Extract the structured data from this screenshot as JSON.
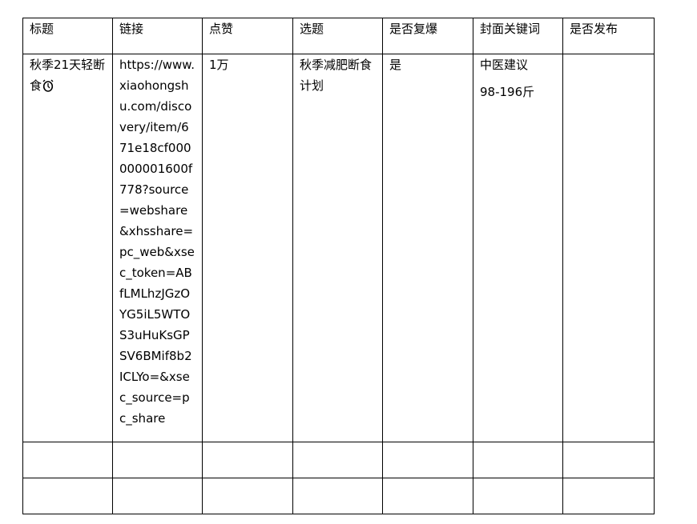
{
  "headers": [
    "标题",
    "链接",
    "点赞",
    "选题",
    "是否复爆",
    "封面关键词",
    "是否发布"
  ],
  "row": {
    "title": "秋季21天轻断食",
    "title_icon": "alarm-clock-icon",
    "link": "https://www.xiaohongshu.com/discovery/item/671e18cf000000001600f778?source=webshare&xhsshare=pc_web&xsec_token=ABfLMLhzJGzOYG5iL5WTOS3uHuKsGPSV6BMif8b2ICLYo=&xsec_source=pc_share",
    "likes": "1万",
    "topic": "秋季减肥断食计划",
    "repeat_viral": "是",
    "cover_keywords": [
      "中医建议",
      "98-196斤"
    ],
    "published": ""
  }
}
